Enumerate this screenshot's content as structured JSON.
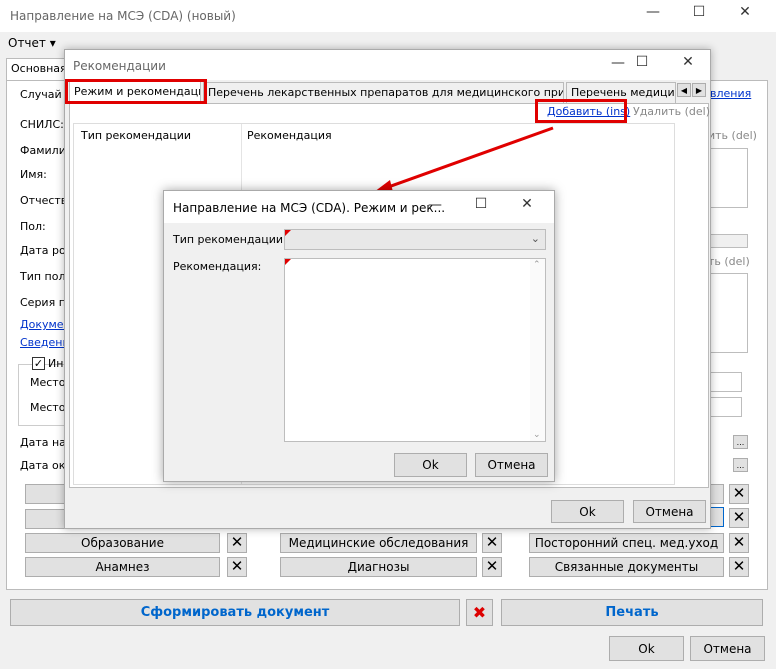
{
  "main": {
    "title": "Направление на МСЭ (CDA) (новый)",
    "menu": "Отчет",
    "tab_main": "Основная",
    "side_labels": [
      "Случай о",
      "СНИЛС:",
      "Фамилия",
      "Имя:",
      "Отчество",
      "Пол:",
      "Дата рож",
      "Тип поли",
      "Серия по"
    ],
    "side_links": [
      "Докумен",
      "Сведени"
    ],
    "checkbox_label": "Ин",
    "place_labels": [
      "Место",
      "Место "
    ],
    "date_labels": [
      "Дата нач",
      "Дата око"
    ],
    "right_link": "вления",
    "right_del_1": "ить (del)",
    "right_del_2": "ть (del)",
    "section_buttons": [
      "Образование",
      "Медицинские обследования",
      "Посторонний спец. мед.уход",
      "Анамнез",
      "Диагнозы",
      "Связанные документы"
    ],
    "form_doc": "Сформировать документ",
    "print": "Печать",
    "ok": "Ok",
    "cancel": "Отмена"
  },
  "rec": {
    "title": "Рекомендации",
    "tabs": [
      "Режим и рекомендации",
      "Перечень лекарственных препаратов для медицинского применения",
      "Перечень медицинс"
    ],
    "add": "Добавить (ins)",
    "delete": "Удалить (del)",
    "columns": [
      "Тип рекомендации",
      "Рекомендация"
    ],
    "ok": "Ok",
    "cancel": "Отмена"
  },
  "dlg": {
    "title": "Направление на МСЭ (CDA). Режим и рек...",
    "type_label": "Тип рекомендации:",
    "type_value": "",
    "rec_label": "Рекомендация:",
    "rec_value": "",
    "ok": "Ok",
    "cancel": "Отмена"
  },
  "colors": {
    "highlight": "#e00000",
    "link": "#0033cc",
    "accent": "#0066cc"
  }
}
